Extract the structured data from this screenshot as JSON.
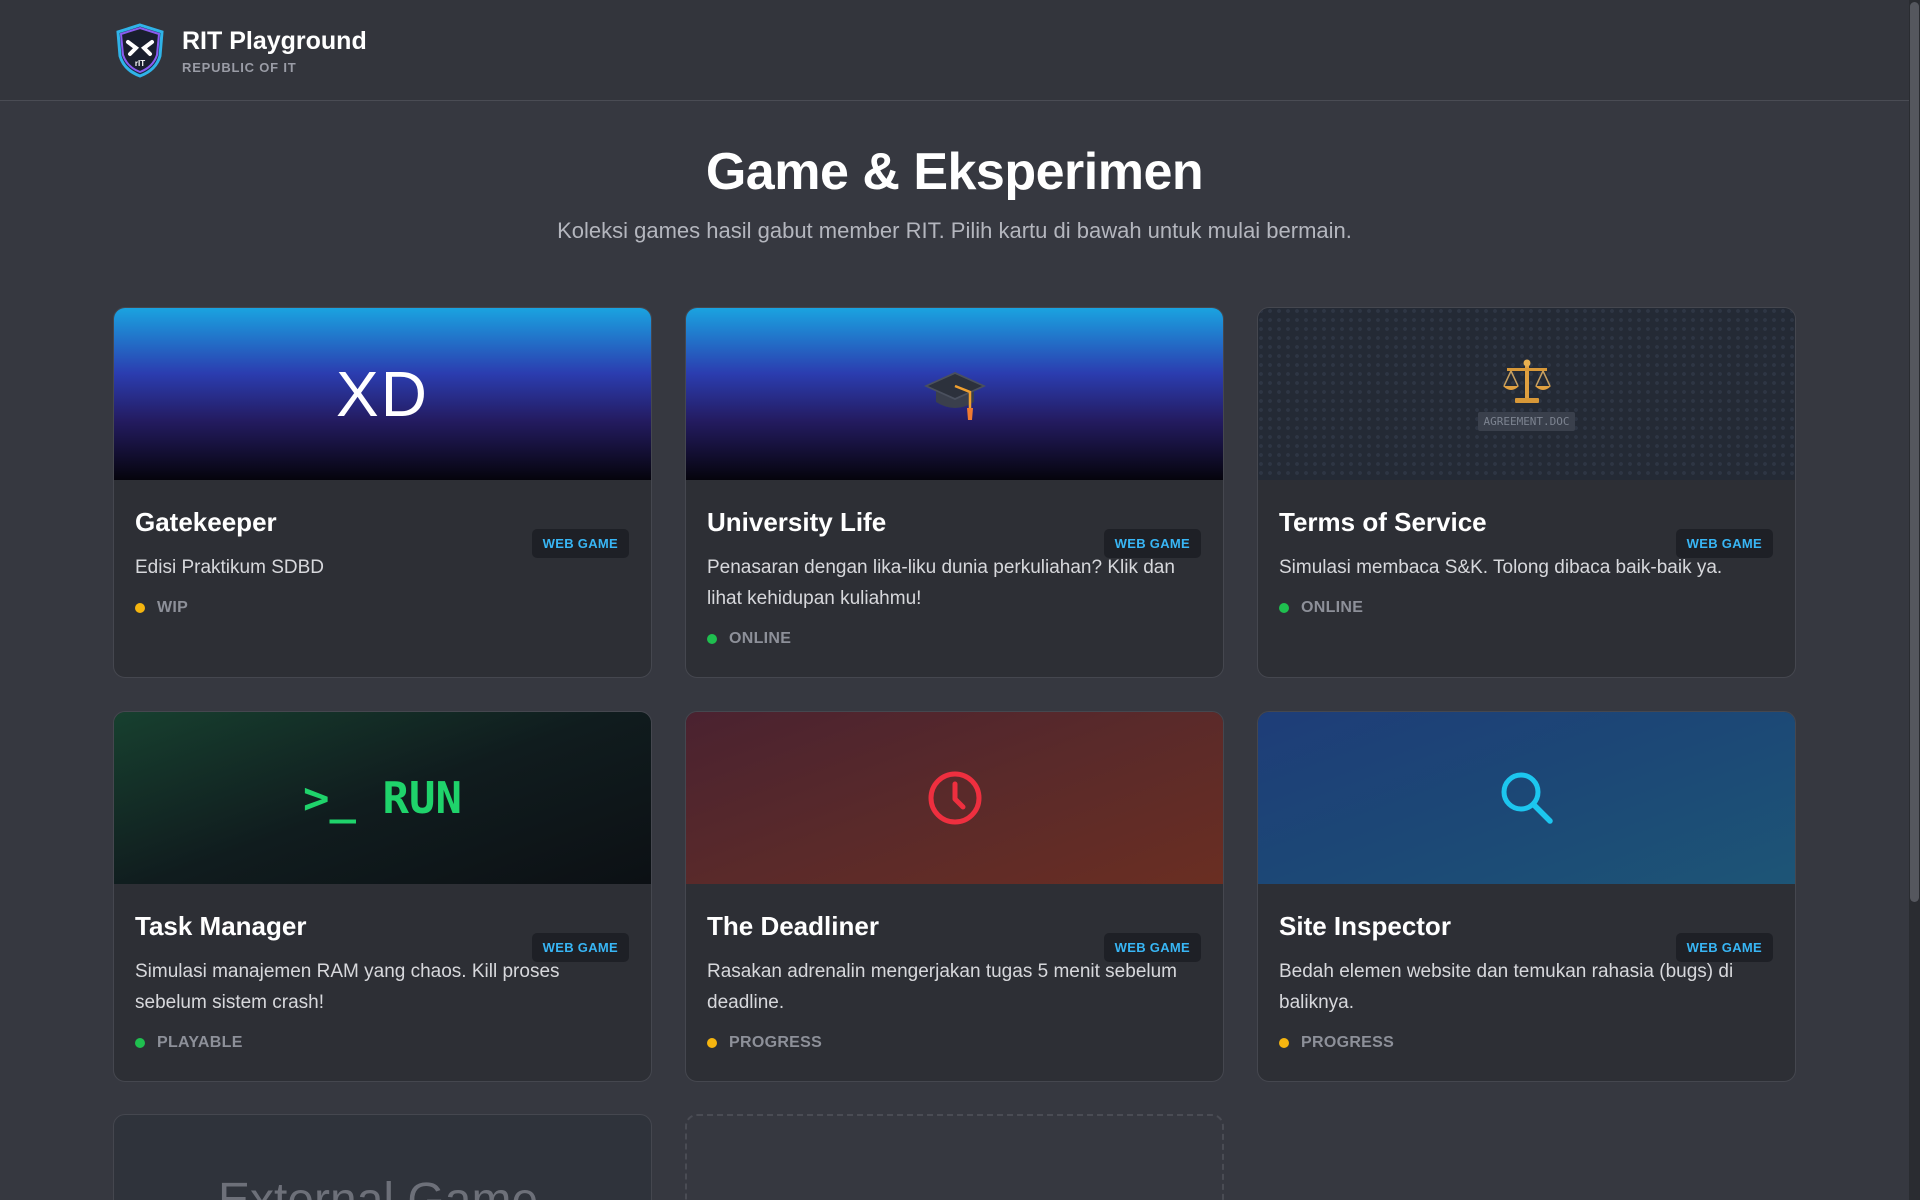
{
  "header": {
    "title": "RIT Playground",
    "subtitle": "REPUBLIC OF IT",
    "logo_text": "rIT"
  },
  "hero": {
    "title": "Game & Eksperimen",
    "subtitle": "Koleksi games hasil gabut member RIT. Pilih kartu di bawah untuk mulai bermain."
  },
  "cards": [
    {
      "title": "Gatekeeper",
      "badge": "WEB GAME",
      "description": "Edisi Praktikum SDBD",
      "status": "WIP",
      "status_color": "#f5b50f",
      "banner_text": "XD"
    },
    {
      "title": "University Life",
      "badge": "WEB GAME",
      "description": "Penasaran dengan lika-liku dunia perkuliahan? Klik dan lihat kehidupan kuliahmu!",
      "status": "ONLINE",
      "status_color": "#1fbf4f",
      "banner_icon": "graduation-cap-icon"
    },
    {
      "title": "Terms of Service",
      "badge": "WEB GAME",
      "description": "Simulasi membaca S&K. Tolong dibaca baik-baik ya.",
      "status": "ONLINE",
      "status_color": "#1fbf4f",
      "banner_icon": "scales-icon",
      "banner_caption": "AGREEMENT.DOC"
    },
    {
      "title": "Task Manager",
      "badge": "WEB GAME",
      "description": "Simulasi manajemen RAM yang chaos. Kill proses sebelum sistem crash!",
      "status": "PLAYABLE",
      "status_color": "#1fbf4f",
      "banner_text": ">_ RUN"
    },
    {
      "title": "The Deadliner",
      "badge": "WEB GAME",
      "description": "Rasakan adrenalin mengerjakan tugas 5 menit sebelum deadline.",
      "status": "PROGRESS",
      "status_color": "#f5b50f",
      "banner_icon": "clock-icon"
    },
    {
      "title": "Site Inspector",
      "badge": "WEB GAME",
      "description": "Bedah elemen website dan temukan rahasia (bugs) di baliknya.",
      "status": "PROGRESS",
      "status_color": "#f5b50f",
      "banner_icon": "magnifier-icon"
    }
  ],
  "external_card": {
    "title": "External Game"
  },
  "colors": {
    "background": "#363840",
    "card": "#2d2f35",
    "badge_text": "#38b6f5",
    "run_green": "#1fd36b",
    "clock_red": "#ee2f3f",
    "magnifier_cyan": "#1cc6ef"
  }
}
